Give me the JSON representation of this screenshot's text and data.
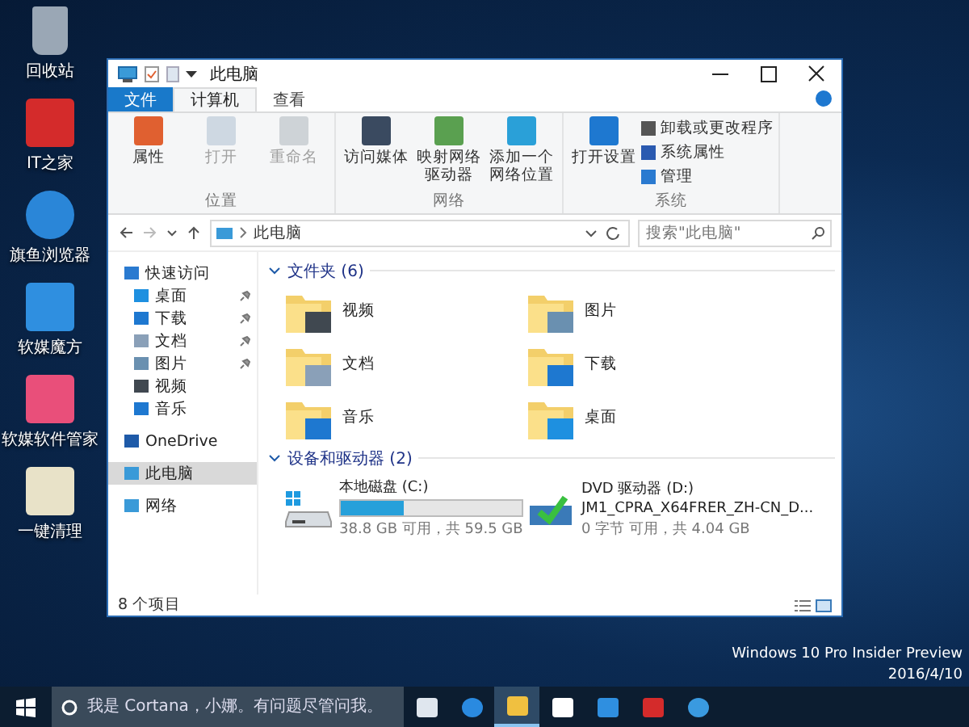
{
  "desktop_icons": [
    {
      "label": "回收站",
      "kind": "trash"
    },
    {
      "label": "IT之家",
      "kind": "it"
    },
    {
      "label": "旗鱼浏览器",
      "kind": "browser"
    },
    {
      "label": "软媒魔方",
      "kind": "cube"
    },
    {
      "label": "软媒软件管家",
      "kind": "manager"
    },
    {
      "label": "一键清理",
      "kind": "cleaner"
    }
  ],
  "window": {
    "title": "此电脑",
    "tabs": [
      {
        "label": "文件",
        "kind": "file",
        "selected": false
      },
      {
        "label": "计算机",
        "kind": "tab",
        "selected": true
      },
      {
        "label": "查看",
        "kind": "tab",
        "selected": false
      }
    ],
    "ribbon_groups": [
      {
        "label": "位置",
        "commands": [
          {
            "label": "属性",
            "kind": "props",
            "disabled": false
          },
          {
            "label": "打开",
            "kind": "open",
            "disabled": true
          },
          {
            "label": "重命名",
            "kind": "rename",
            "disabled": true
          }
        ]
      },
      {
        "label": "网络",
        "commands": [
          {
            "label": "访问媒体",
            "kind": "media",
            "disabled": false
          },
          {
            "label": "映射网络驱动器",
            "kind": "drive",
            "disabled": false
          },
          {
            "label": "添加一个网络位置",
            "kind": "netloc",
            "disabled": false
          }
        ]
      },
      {
        "label": "系统",
        "commands": [
          {
            "label": "打开设置",
            "kind": "settings",
            "disabled": false
          }
        ],
        "small_commands": [
          {
            "label": "卸载或更改程序",
            "kind": "uninstall"
          },
          {
            "label": "系统属性",
            "kind": "sysprops"
          },
          {
            "label": "管理",
            "kind": "manage"
          }
        ]
      }
    ],
    "address": {
      "path": "此电脑",
      "search_placeholder": "搜索\"此电脑\""
    },
    "nav": [
      {
        "label": "快速访问",
        "kind": "star",
        "selected": false,
        "children": [
          {
            "label": "桌面",
            "kind": "desktop",
            "pinned": true
          },
          {
            "label": "下载",
            "kind": "download",
            "pinned": true
          },
          {
            "label": "文档",
            "kind": "doc",
            "pinned": true
          },
          {
            "label": "图片",
            "kind": "picture",
            "pinned": true
          },
          {
            "label": "视频",
            "kind": "video",
            "pinned": false
          },
          {
            "label": "音乐",
            "kind": "music",
            "pinned": false
          }
        ]
      },
      {
        "label": "OneDrive",
        "kind": "cloud",
        "selected": false
      },
      {
        "label": "此电脑",
        "kind": "pc",
        "selected": true
      },
      {
        "label": "网络",
        "kind": "network",
        "selected": false
      }
    ],
    "folders": {
      "title": "文件夹 (6)",
      "expanded": true,
      "items": [
        {
          "label": "视频",
          "kind": "video"
        },
        {
          "label": "图片",
          "kind": "picture"
        },
        {
          "label": "文档",
          "kind": "doc"
        },
        {
          "label": "下载",
          "kind": "download"
        },
        {
          "label": "音乐",
          "kind": "music"
        },
        {
          "label": "桌面",
          "kind": "desktop"
        }
      ]
    },
    "devices": {
      "title": "设备和驱动器 (2)",
      "expanded": true,
      "items": [
        {
          "kind": "disk",
          "name": "本地磁盘 (C:)",
          "detail": "38.8 GB 可用，共 59.5 GB",
          "level": 0.35
        },
        {
          "kind": "dvd",
          "name": "DVD 驱动器 (D:)",
          "label": "JM1_CPRA_X64FRER_ZH-CN_D...",
          "detail": "0 字节 可用，共 4.04 GB"
        }
      ]
    },
    "status": "8 个项目"
  },
  "taskbar": {
    "search_placeholder": "我是 Cortana，小娜。有问题尽管问我。",
    "apps": [
      {
        "kind": "taskview",
        "active": false
      },
      {
        "kind": "edge",
        "active": false
      },
      {
        "kind": "explorer",
        "active": true
      },
      {
        "kind": "store",
        "active": false
      },
      {
        "kind": "cube",
        "active": false
      },
      {
        "kind": "it",
        "active": false
      },
      {
        "kind": "browser",
        "active": false
      }
    ],
    "edition": "Windows 10 Pro Insider Preview",
    "date": "2016/4/10"
  }
}
